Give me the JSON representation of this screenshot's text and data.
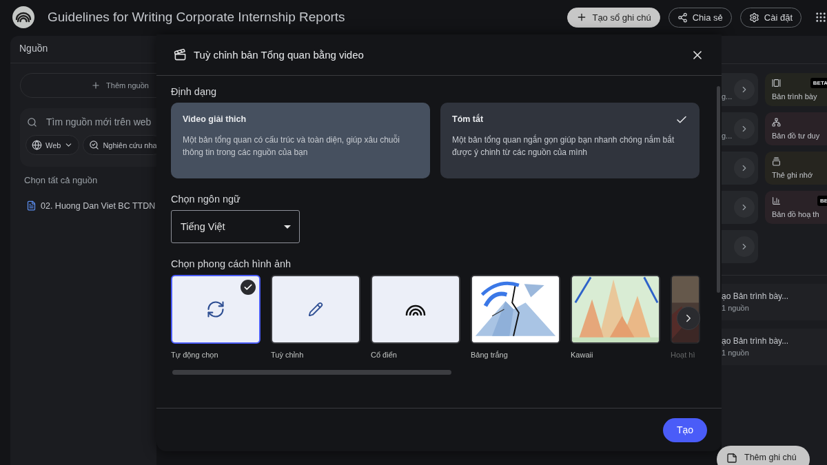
{
  "header": {
    "title": "Guidelines for Writing Corporate Internship Reports",
    "buttons": [
      {
        "label": "Tạo sổ ghi chú",
        "kind": "primary"
      },
      {
        "label": "Chia sẻ",
        "kind": "outline"
      },
      {
        "label": "Cài đặt",
        "kind": "outline"
      }
    ]
  },
  "sources": {
    "title": "Nguồn",
    "add_button": "Thêm nguồn",
    "search": {
      "placeholder": "Tìm nguồn mới trên web",
      "chips": [
        {
          "label": "Web",
          "kind": "dropdown"
        },
        {
          "label": "Nghiên cứu nha",
          "kind": "action"
        }
      ]
    },
    "select_all": "Chọn tất cả nguồn",
    "items": [
      {
        "name": "02. Huong Dan Viet BC TTDN"
      }
    ]
  },
  "studio": {
    "tiles": [
      {
        "kind": "overview",
        "text": "g...",
        "card": {
          "label": "Bản trình bày",
          "badge": "BETA",
          "color": "#24251f"
        }
      },
      {
        "kind": "overview",
        "text": "g...",
        "card": {
          "label": "Bản đồ tư duy",
          "color": "#2a2227"
        }
      },
      {
        "kind": "overview",
        "card": {
          "label": "Thẻ ghi nhớ",
          "color": "#26251f"
        }
      },
      {
        "kind": "overview",
        "card": {
          "label": "Bản đồ hoạ th",
          "badge": "BE",
          "color": "#2a2227"
        }
      },
      {
        "kind": "overview"
      }
    ],
    "notes": [
      {
        "title": "ạo Bản trình bày...",
        "meta": "1 nguồn"
      },
      {
        "title": "ạo Bản trình bày...",
        "meta": "1 nguồn"
      }
    ],
    "add_note": "Thêm ghi chú"
  },
  "dialog": {
    "title": "Tuỳ chỉnh bản Tổng quan bằng video",
    "format_label": "Định dạng",
    "formats": [
      {
        "title": "Video giải thich",
        "description": "Một bản tổng quan có cấu trúc và toàn diện, giúp xâu chuỗi thông tin trong các nguồn của bạn",
        "selected": false,
        "hovered": true
      },
      {
        "title": "Tóm tắt",
        "description": "Một bản tổng quan ngắn gọn giúp bạn nhanh chóng nắm bắt được ý chinh từ các nguồn của mình",
        "selected": true,
        "hovered": false
      }
    ],
    "language_label": "Chọn ngôn ngữ",
    "language": "Tiếng Việt",
    "style_label": "Chọn phong cách hình ảnh",
    "styles": [
      {
        "label": "Tự động chọn",
        "kind": "icon",
        "selected": true,
        "faded": false
      },
      {
        "label": "Tuỳ chỉnh",
        "kind": "icon",
        "selected": false,
        "faded": false
      },
      {
        "label": "Cổ điển",
        "kind": "icon",
        "selected": false,
        "faded": false
      },
      {
        "label": "Bảng trắng",
        "kind": "picture",
        "selected": false,
        "faded": false
      },
      {
        "label": "Kawaii",
        "kind": "picture",
        "selected": false,
        "faded": false
      },
      {
        "label": "Hoạt hì",
        "kind": "picture",
        "selected": false,
        "faded": true
      }
    ],
    "create_button": "Tạo"
  }
}
